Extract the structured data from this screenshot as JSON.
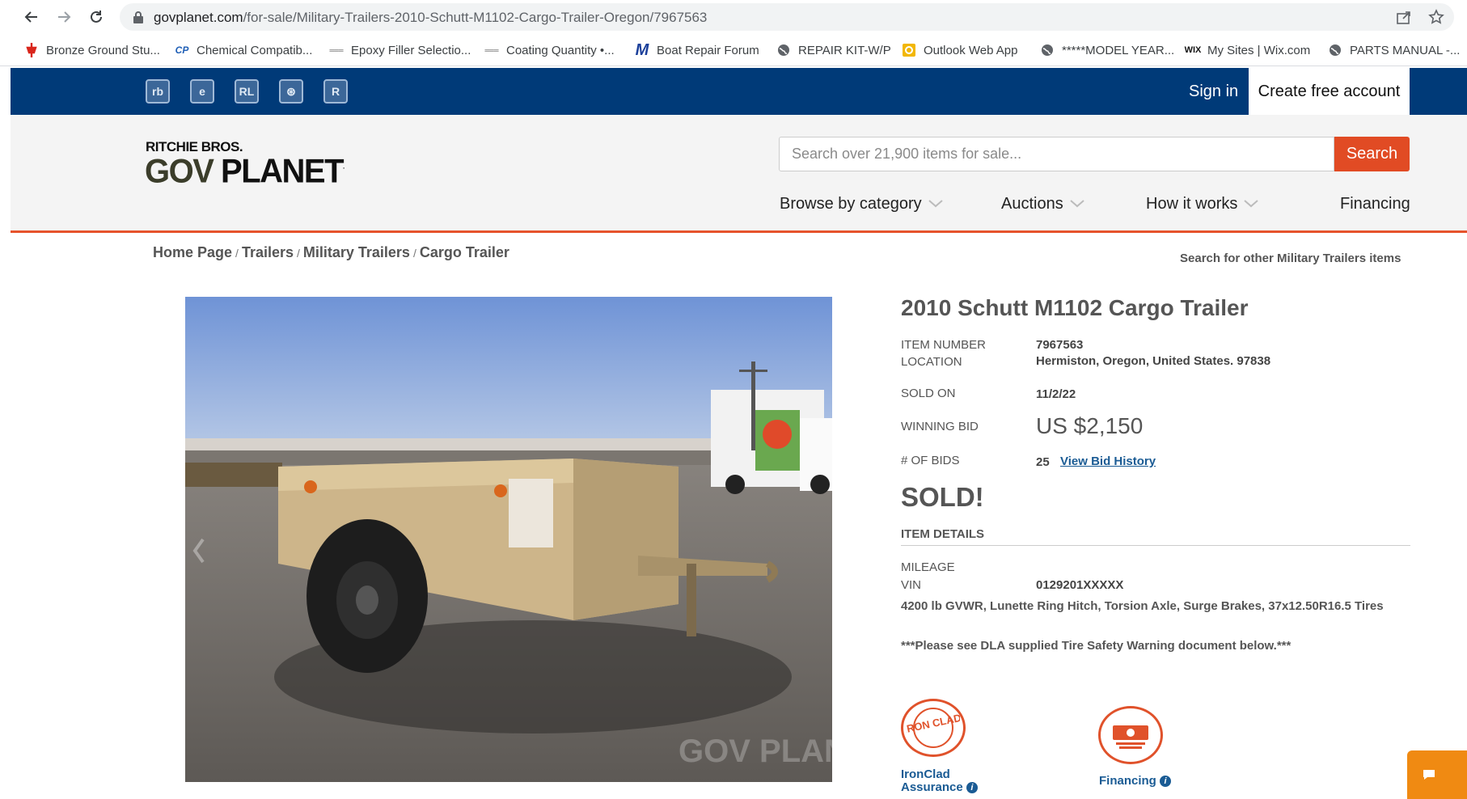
{
  "browser": {
    "url_host": "govplanet.com",
    "url_path": "/for-sale/Military-Trailers-2010-Schutt-M1102-Cargo-Trailer-Oregon/7967563",
    "bookmarks": [
      {
        "label": "Bronze Ground Stu...",
        "icon": "red-marker-icon"
      },
      {
        "label": "Chemical Compatib...",
        "icon": "cp-icon"
      },
      {
        "label": "Epoxy Filler Selectio...",
        "icon": "dash-logo-icon"
      },
      {
        "label": "Coating Quantity •...",
        "icon": "dash-logo-icon"
      },
      {
        "label": "Boat Repair Forum",
        "icon": "m-logo-icon"
      },
      {
        "label": "REPAIR KIT-W/P",
        "icon": "globe-icon"
      },
      {
        "label": "Outlook Web App",
        "icon": "outlook-icon"
      },
      {
        "label": "*****MODEL YEAR...",
        "icon": "globe-icon"
      },
      {
        "label": "My Sites | Wix.com",
        "icon": "wix-icon"
      },
      {
        "label": "PARTS MANUAL -...",
        "icon": "globe-icon"
      }
    ]
  },
  "topbar": {
    "brand_icons": [
      "rb",
      "e",
      "RL",
      "⊛",
      "R"
    ],
    "sign_in": "Sign in",
    "create_account": "Create free account"
  },
  "header": {
    "logo_top": "RITCHIE BROS.",
    "logo_gov": "GOV",
    "logo_planet": "PLANET",
    "search_placeholder": "Search over 21,900 items for sale...",
    "search_button": "Search",
    "nav": {
      "browse": "Browse by category",
      "auctions": "Auctions",
      "how": "How it works",
      "financing": "Financing"
    }
  },
  "breadcrumb": [
    "Home Page",
    "Trailers",
    "Military Trailers",
    "Cargo Trailer"
  ],
  "other_search": "Search for other Military Trailers items",
  "item": {
    "title": "2010 Schutt M1102 Cargo Trailer",
    "labels": {
      "item_number": "ITEM NUMBER",
      "location": "LOCATION",
      "sold_on": "SOLD ON",
      "winning_bid": "WINNING BID",
      "num_bids": "# OF BIDS",
      "mileage": "MILEAGE",
      "vin": "VIN"
    },
    "item_number": "7967563",
    "location": "Hermiston, Oregon, United States. 97838",
    "sold_on": "11/2/22",
    "winning_bid": "US $2,150",
    "num_bids": "25",
    "bid_history_link": "View Bid History",
    "sold_text": "SOLD!",
    "details_heading": "ITEM DETAILS",
    "vin": "0129201XXXXX",
    "description": "4200 lb GVWR, Lunette Ring Hitch, Torsion Axle, Surge Brakes, 37x12.50R16.5 Tires",
    "warning": "***Please see DLA supplied Tire Safety Warning document below.***",
    "badges": {
      "ironclad_line1": "IronClad",
      "ironclad_line2": "Assurance",
      "ironclad_logo_text": "IRON CLAD",
      "financing": "Financing"
    },
    "photo_watermark": "GOV PLANET"
  },
  "colors": {
    "topbar_blue": "#003a78",
    "accent_orange": "#e14b24",
    "link_blue": "#1a5b94",
    "chat_orange": "#f08a12"
  }
}
